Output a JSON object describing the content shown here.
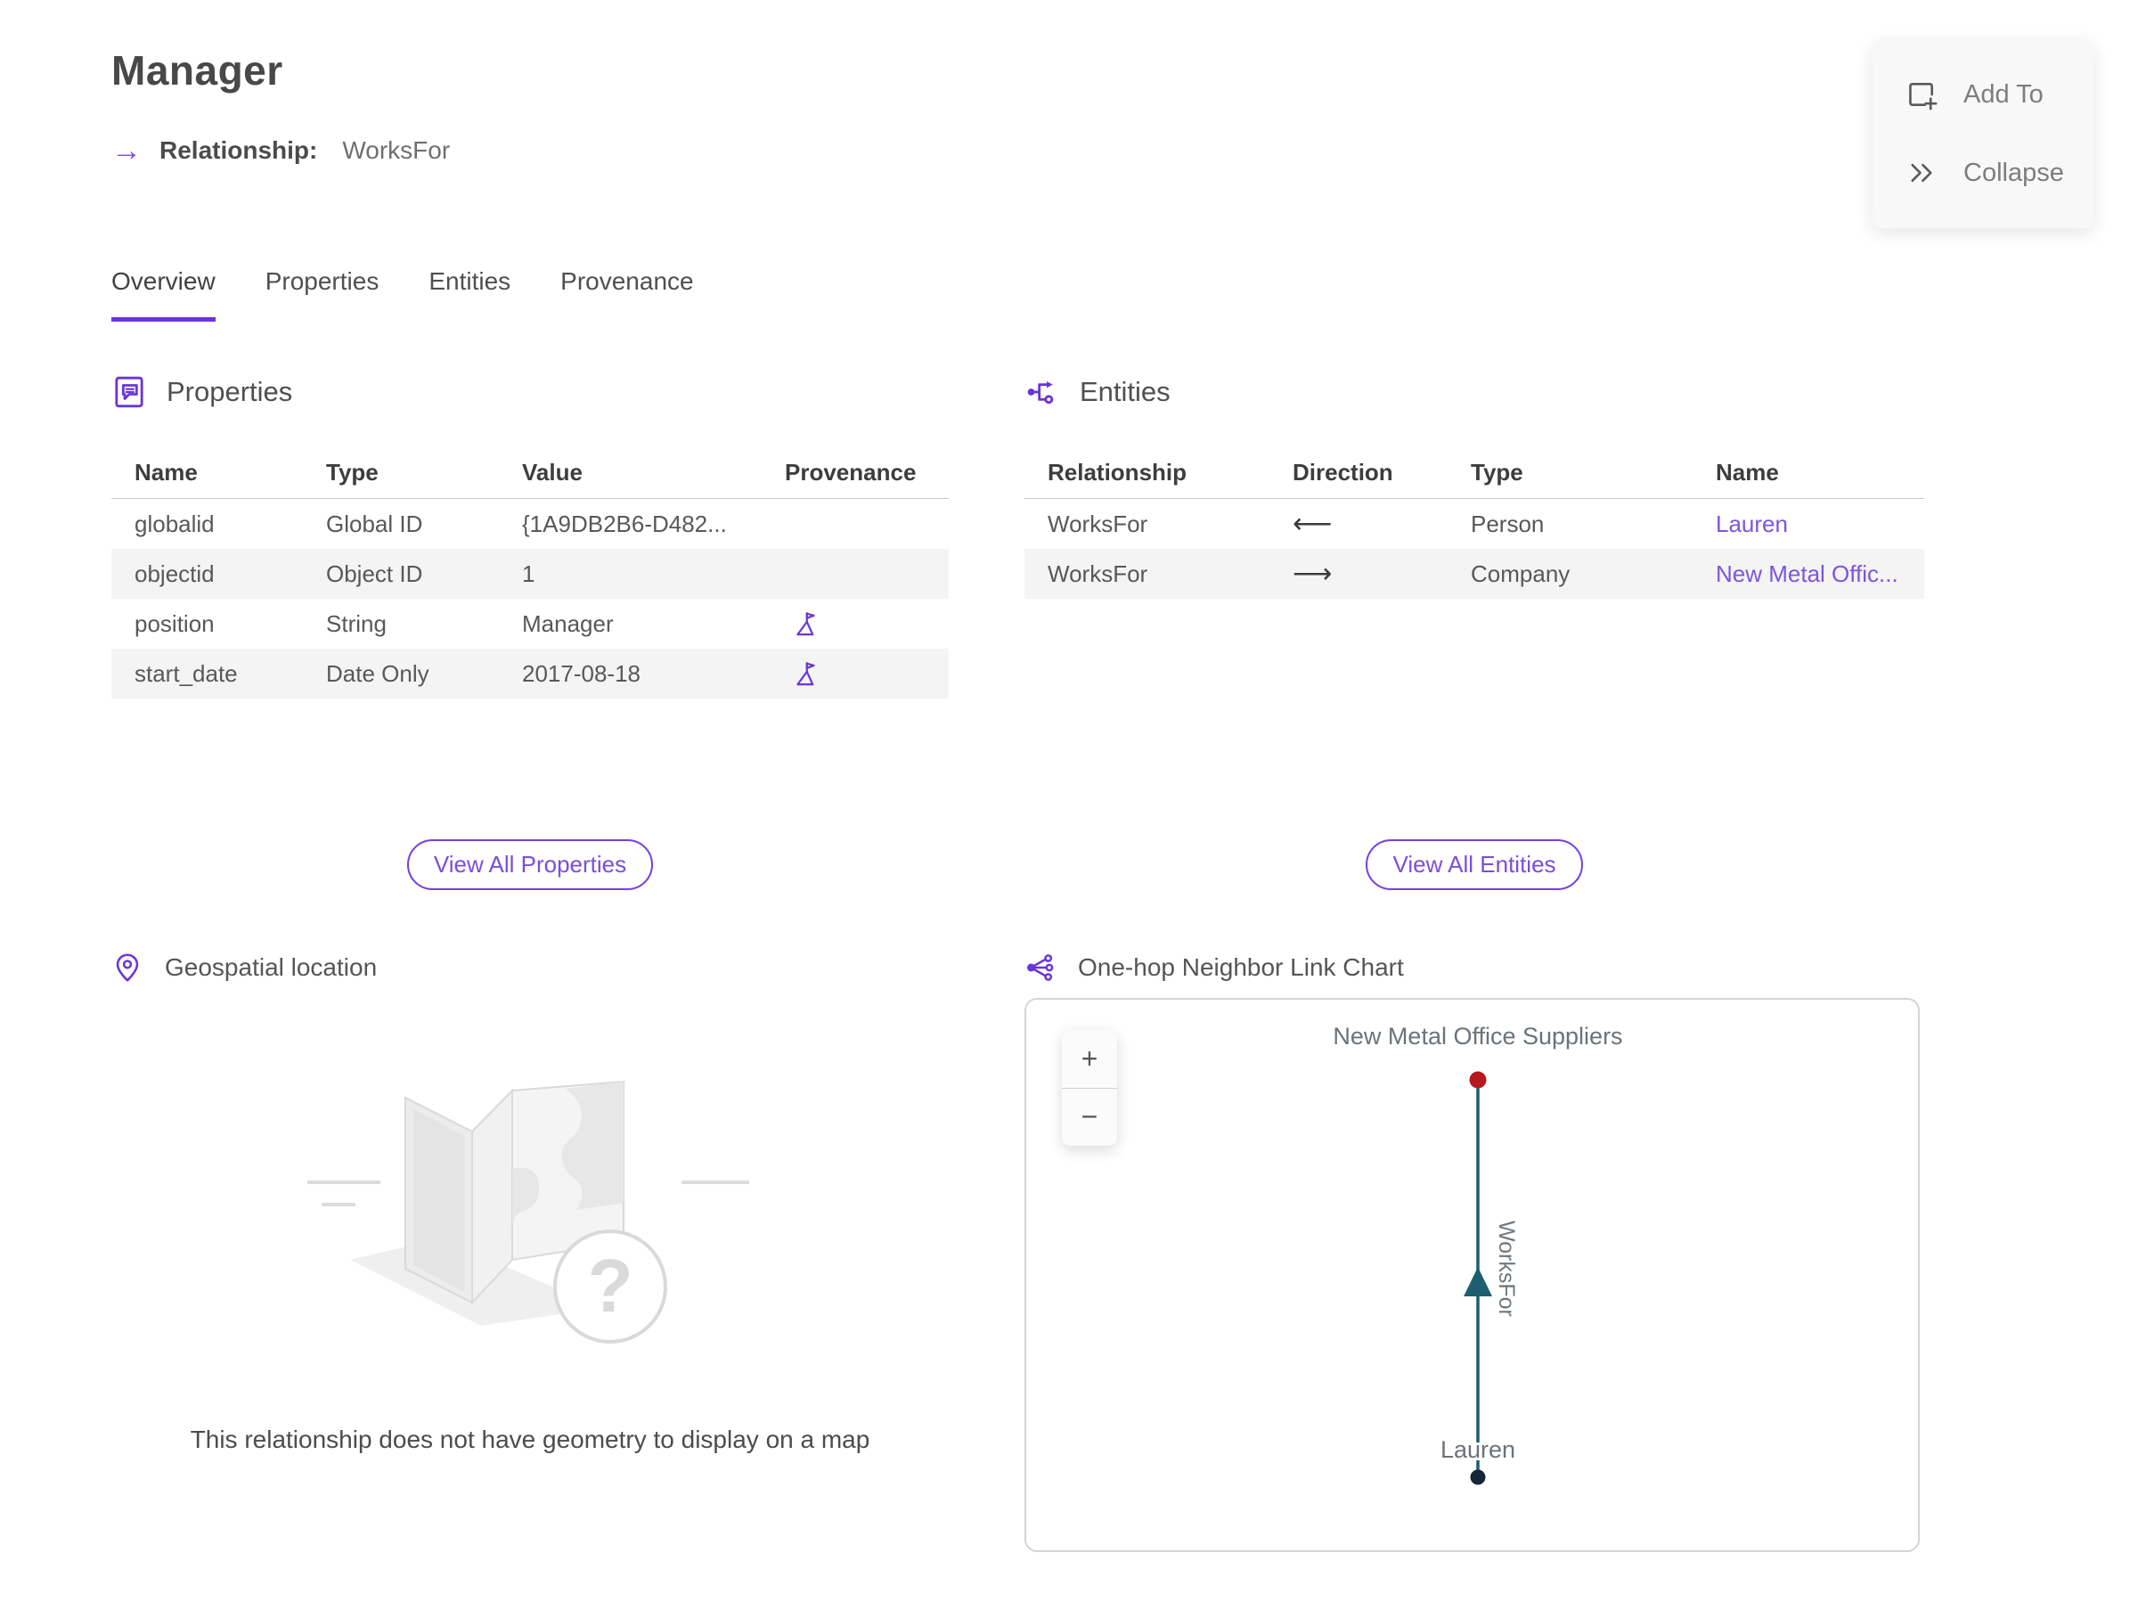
{
  "page": {
    "title": "Manager",
    "subtitle_label": "Relationship:",
    "subtitle_value": "WorksFor",
    "relationship_arrow": "→"
  },
  "actions": {
    "add_to": "Add To",
    "collapse": "Collapse"
  },
  "tabs": [
    {
      "label": "Overview",
      "active": true
    },
    {
      "label": "Properties",
      "active": false
    },
    {
      "label": "Entities",
      "active": false
    },
    {
      "label": "Provenance",
      "active": false
    }
  ],
  "properties_section": {
    "title": "Properties",
    "headers": [
      "Name",
      "Type",
      "Value",
      "Provenance"
    ],
    "rows": [
      {
        "name": "globalid",
        "type": "Global ID",
        "value": "{1A9DB2B6-D482...",
        "has_provenance": false
      },
      {
        "name": "objectid",
        "type": "Object ID",
        "value": "1",
        "has_provenance": false
      },
      {
        "name": "position",
        "type": "String",
        "value": "Manager",
        "has_provenance": true
      },
      {
        "name": "start_date",
        "type": "Date Only",
        "value": "2017-08-18",
        "has_provenance": true
      }
    ],
    "view_all_label": "View All Properties"
  },
  "entities_section": {
    "title": "Entities",
    "headers": [
      "Relationship",
      "Direction",
      "Type",
      "Name"
    ],
    "rows": [
      {
        "relationship": "WorksFor",
        "direction": "⟵",
        "type": "Person",
        "name": "Lauren"
      },
      {
        "relationship": "WorksFor",
        "direction": "⟶",
        "type": "Company",
        "name": "New Metal Offic..."
      }
    ],
    "view_all_label": "View All Entities"
  },
  "geospatial_section": {
    "title": "Geospatial location",
    "empty_message": "This relationship does not have geometry to display on a map"
  },
  "link_chart_section": {
    "title": "One-hop Neighbor Link Chart",
    "zoom_in": "+",
    "zoom_out": "−",
    "top_node_label": "New Metal Office Suppliers",
    "bottom_node_label": "Lauren",
    "edge_label": "WorksFor"
  },
  "colors": {
    "accent_purple": "#6a35d8",
    "link_purple": "#7c55dd",
    "edge_teal": "#1d5e70",
    "top_node_red": "#b5191f",
    "bottom_node_navy": "#152638"
  }
}
